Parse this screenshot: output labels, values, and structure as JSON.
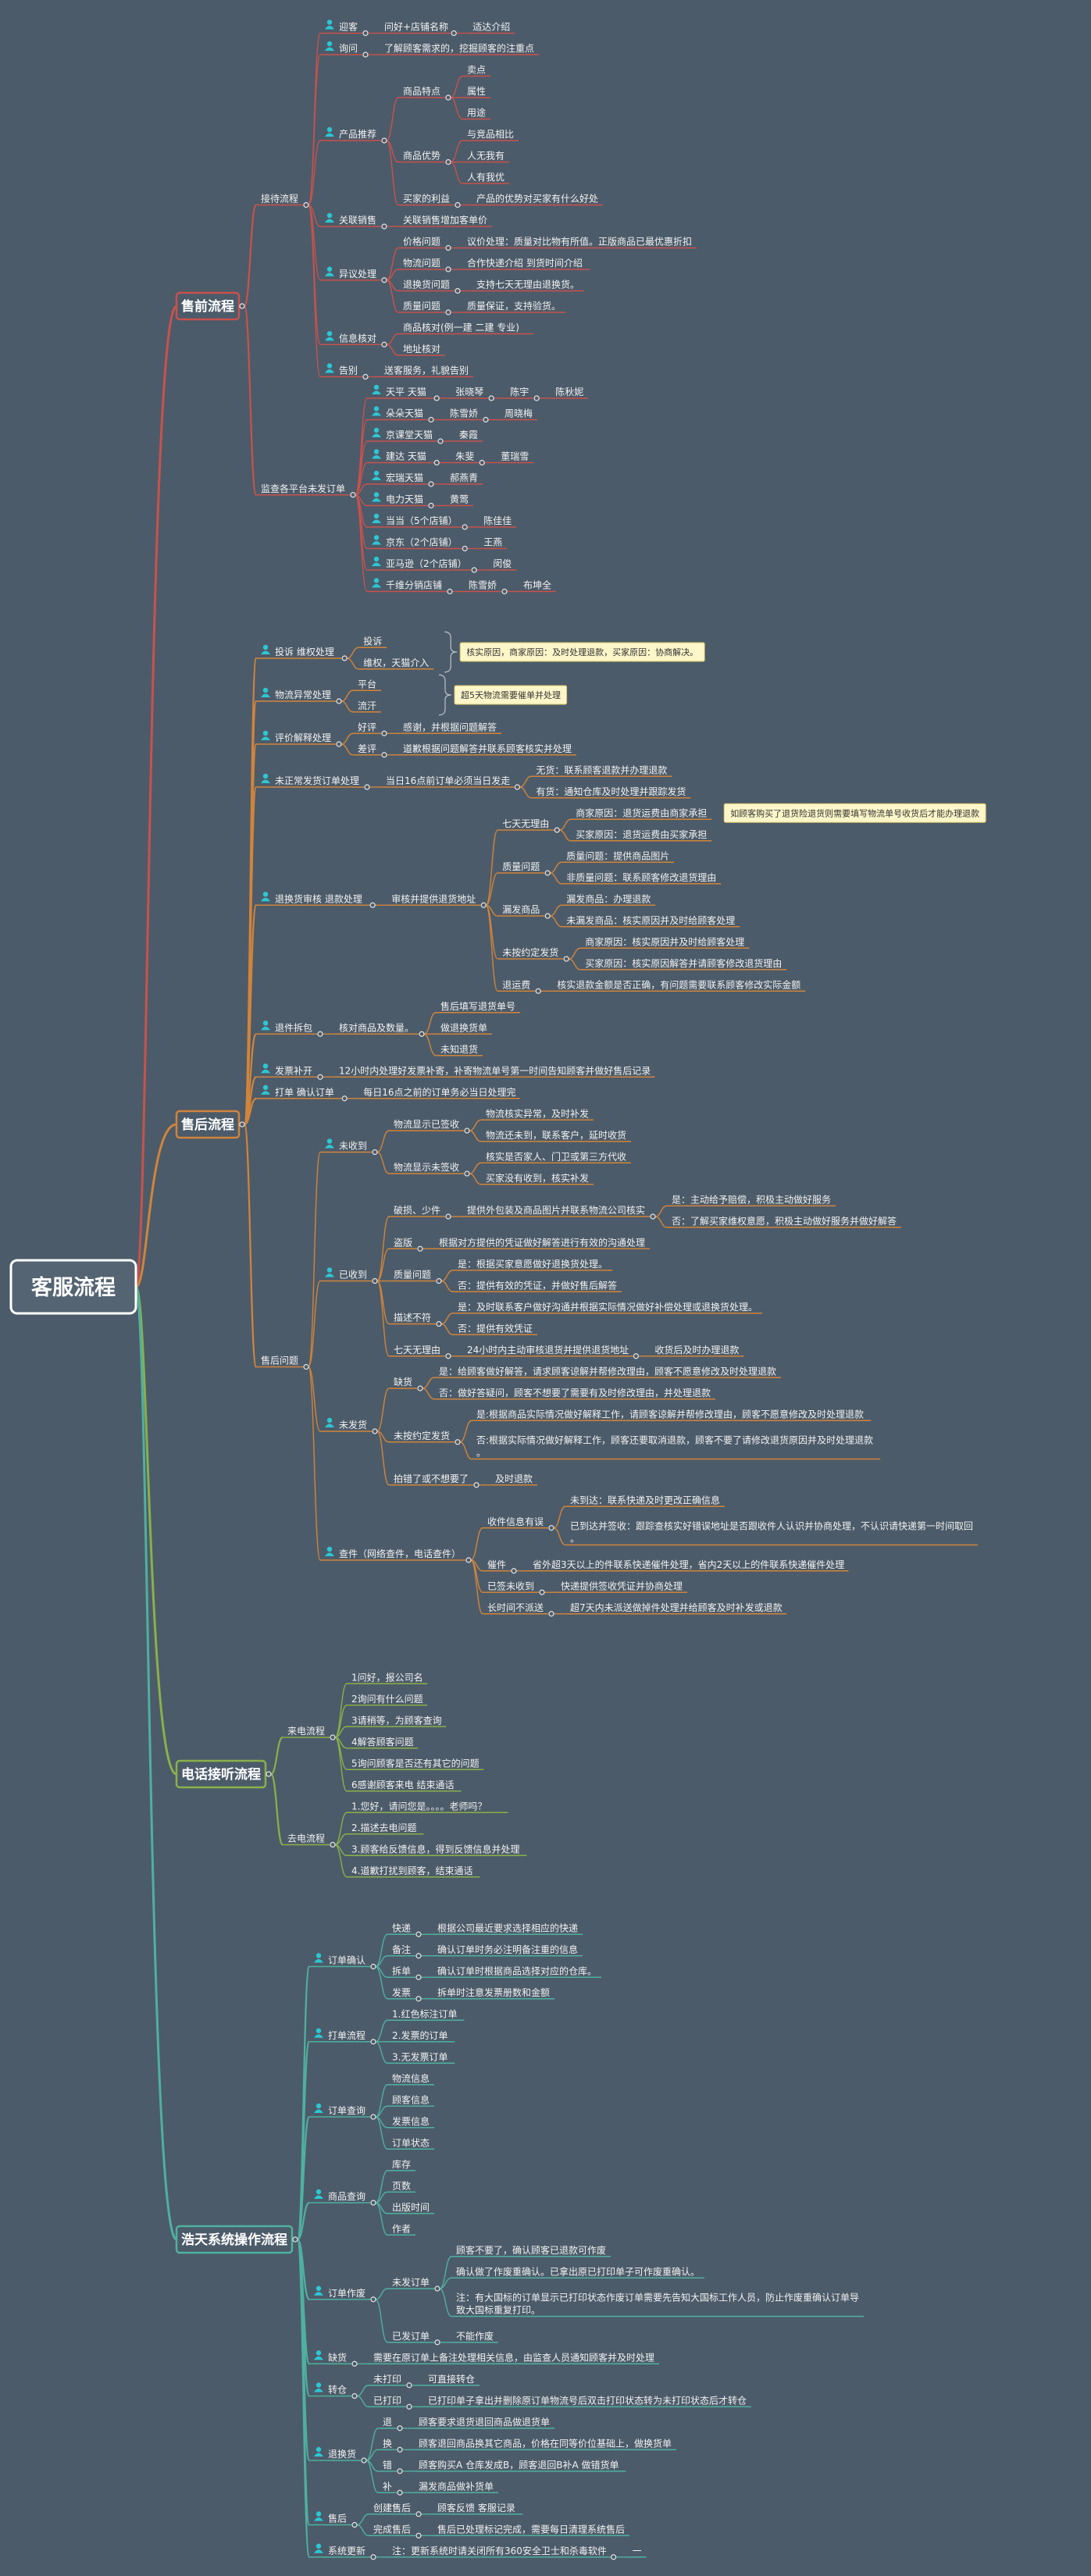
{
  "root": "客服流程",
  "colors": {
    "bg": "#4c5b69",
    "c1": "#c8524d",
    "c2": "#d1843b",
    "c3": "#8ab04a",
    "c4": "#4fb0a0",
    "person": "#2cc7d4",
    "note_bg": "#fdf6c8"
  },
  "tree": [
    {
      "t": "售前流程",
      "c": [
        {
          "t": "接待流程",
          "c": [
            {
              "t": "迎客",
              "p": 1,
              "c": [
                {
                  "t": "问好+店铺名称",
                  "c": [
                    {
                      "t": "适达介绍"
                    }
                  ]
                }
              ]
            },
            {
              "t": "询问",
              "p": 1,
              "c": [
                {
                  "t": "了解顾客需求的，挖掘顾客的注重点"
                }
              ]
            },
            {
              "t": "产品推荐",
              "p": 1,
              "c": [
                {
                  "t": "商品特点",
                  "c": [
                    {
                      "t": "卖点"
                    },
                    {
                      "t": "属性"
                    },
                    {
                      "t": "用途"
                    }
                  ]
                },
                {
                  "t": "商品优势",
                  "c": [
                    {
                      "t": "与竞品相比"
                    },
                    {
                      "t": "人无我有"
                    },
                    {
                      "t": "人有我优"
                    }
                  ]
                },
                {
                  "t": "买家的利益",
                  "c": [
                    {
                      "t": "产品的优势对买家有什么好处"
                    }
                  ]
                }
              ]
            },
            {
              "t": "关联销售",
              "p": 1,
              "c": [
                {
                  "t": "关联销售增加客单价"
                }
              ]
            },
            {
              "t": "异议处理",
              "p": 1,
              "c": [
                {
                  "t": "价格问题",
                  "c": [
                    {
                      "t": "议价处理：质量对比物有所值。正版商品已最优惠折扣"
                    }
                  ]
                },
                {
                  "t": "物流问题",
                  "c": [
                    {
                      "t": "合作快递介绍 到货时间介绍"
                    }
                  ]
                },
                {
                  "t": "退换货问题",
                  "c": [
                    {
                      "t": "支持七天无理由退换货。"
                    }
                  ]
                },
                {
                  "t": "质量问题",
                  "c": [
                    {
                      "t": "质量保证，支持验货。"
                    }
                  ]
                }
              ]
            },
            {
              "t": "信息核对",
              "p": 1,
              "c": [
                {
                  "t": "商品核对(例一建 二建 专业)"
                },
                {
                  "t": "地址核对"
                }
              ]
            },
            {
              "t": "告别",
              "p": 1,
              "c": [
                {
                  "t": "送客服务，礼貌告别"
                }
              ]
            }
          ]
        },
        {
          "t": "监查各平台未发订单",
          "c": [
            {
              "t": "天平 天猫",
              "p": 1,
              "c": [
                {
                  "t": "张晓琴",
                  "c": [
                    {
                      "t": "陈宇",
                      "c": [
                        {
                          "t": "陈秋妮"
                        }
                      ]
                    }
                  ]
                }
              ]
            },
            {
              "t": "朵朵天猫",
              "p": 1,
              "c": [
                {
                  "t": "陈雪娇",
                  "c": [
                    {
                      "t": "周晓梅"
                    }
                  ]
                }
              ]
            },
            {
              "t": "京课堂天猫",
              "p": 1,
              "c": [
                {
                  "t": "秦霞"
                }
              ]
            },
            {
              "t": "建达 天猫",
              "p": 1,
              "c": [
                {
                  "t": "朱斐",
                  "c": [
                    {
                      "t": "董瑞雪"
                    }
                  ]
                }
              ]
            },
            {
              "t": "宏瑞天猫",
              "p": 1,
              "c": [
                {
                  "t": "郝燕青"
                }
              ]
            },
            {
              "t": "电力天猫",
              "p": 1,
              "c": [
                {
                  "t": "黄莺"
                }
              ]
            },
            {
              "t": "当当（5个店铺）",
              "p": 1,
              "c": [
                {
                  "t": "陈佳佳"
                }
              ]
            },
            {
              "t": "京东（2个店铺）",
              "p": 1,
              "c": [
                {
                  "t": "王燕"
                }
              ]
            },
            {
              "t": "亚马逊（2个店铺）",
              "p": 1,
              "c": [
                {
                  "t": "闵俊"
                }
              ]
            },
            {
              "t": "千维分销店铺",
              "p": 1,
              "c": [
                {
                  "t": "陈雪娇",
                  "c": [
                    {
                      "t": "布坤全"
                    }
                  ]
                }
              ]
            }
          ]
        }
      ]
    },
    {
      "t": "售后流程",
      "c": [
        {
          "t": "投诉 维权处理",
          "p": 1,
          "note": "核实原因，商家原因：及时处理退款，买家原因：协商解决。",
          "c": [
            {
              "t": "投诉"
            },
            {
              "t": "维权，天猫介入"
            }
          ]
        },
        {
          "t": "物流异常处理",
          "p": 1,
          "note": "超5天物流需要催单并处理",
          "c": [
            {
              "t": "平台"
            },
            {
              "t": "流汗"
            }
          ]
        },
        {
          "t": "评价解释处理",
          "p": 1,
          "c": [
            {
              "t": "好评",
              "c": [
                {
                  "t": "感谢，并根据问题解答"
                }
              ]
            },
            {
              "t": "差评",
              "c": [
                {
                  "t": "道歉根据问题解答并联系顾客核实并处理"
                }
              ]
            }
          ]
        },
        {
          "t": "未正常发货订单处理",
          "p": 1,
          "c": [
            {
              "t": "当日16点前订单必须当日发走",
              "c": [
                {
                  "t": "无货：联系顾客退款并办理退款"
                },
                {
                  "t": "有货：通知仓库及时处理并跟踪发货"
                }
              ]
            }
          ]
        },
        {
          "t": "退换货审核 退款处理",
          "p": 1,
          "c": [
            {
              "t": "审核并提供退货地址",
              "c": [
                {
                  "t": "七天无理由",
                  "c": [
                    {
                      "t": "商家原因：退货运费由商家承担",
                      "note": "如顾客购买了退货险退货则需要填写物流单号收货后才能办理退款"
                    },
                    {
                      "t": "买家原因：退货运费由买家承担"
                    }
                  ]
                },
                {
                  "t": "质量问题",
                  "c": [
                    {
                      "t": "质量问题：提供商品图片"
                    },
                    {
                      "t": "非质量问题：联系顾客修改退货理由"
                    }
                  ]
                },
                {
                  "t": "漏发商品",
                  "c": [
                    {
                      "t": "漏发商品：办理退款"
                    },
                    {
                      "t": "未漏发商品：核实原因并及时给顾客处理"
                    }
                  ]
                },
                {
                  "t": "未按约定发货",
                  "c": [
                    {
                      "t": "商家原因：核实原因并及时给顾客处理"
                    },
                    {
                      "t": "买家原因：核实原因解答并请顾客修改退货理由"
                    }
                  ]
                },
                {
                  "t": "退运费",
                  "c": [
                    {
                      "t": "核实退款金额是否正确，有问题需要联系顾客修改实际金额"
                    }
                  ]
                }
              ]
            }
          ]
        },
        {
          "t": "退件拆包",
          "p": 1,
          "c": [
            {
              "t": "核对商品及数量。",
              "c": [
                {
                  "t": "售后填写退货单号"
                },
                {
                  "t": "做退换货单"
                },
                {
                  "t": "未知退货"
                }
              ]
            }
          ]
        },
        {
          "t": "发票补开",
          "p": 1,
          "c": [
            {
              "t": "12小时内处理好发票补寄，补寄物流单号第一时间告知顾客并做好售后记录"
            }
          ]
        },
        {
          "t": "打单 确认订单",
          "p": 1,
          "c": [
            {
              "t": "每日16点之前的订单务必当日处理完"
            }
          ]
        },
        {
          "t": "售后问题",
          "c": [
            {
              "t": "未收到",
              "p": 1,
              "c": [
                {
                  "t": "物流显示已签收",
                  "c": [
                    {
                      "t": "物流核实异常，及时补发"
                    },
                    {
                      "t": "物流还未到，联系客户，延时收货"
                    }
                  ]
                },
                {
                  "t": "物流显示未签收",
                  "c": [
                    {
                      "t": "核实是否家人、门卫或第三方代收"
                    },
                    {
                      "t": "买家没有收到，核实补发"
                    }
                  ]
                }
              ]
            },
            {
              "t": "已收到",
              "p": 1,
              "c": [
                {
                  "t": "破损、少件",
                  "c": [
                    {
                      "t": "提供外包装及商品图片并联系物流公司核实",
                      "c": [
                        {
                          "t": "是：主动给予赔偿，积极主动做好服务"
                        },
                        {
                          "t": "否：了解买家维权意愿，积极主动做好服务并做好解答"
                        }
                      ]
                    }
                  ]
                },
                {
                  "t": "盗版",
                  "c": [
                    {
                      "t": "根据对方提供的凭证做好解答进行有效的沟通处理"
                    }
                  ]
                },
                {
                  "t": "质量问题",
                  "c": [
                    {
                      "t": "是：根据买家意愿做好退换货处理。"
                    },
                    {
                      "t": "否：提供有效的凭证，并做好售后解答"
                    }
                  ]
                },
                {
                  "t": "描述不符",
                  "c": [
                    {
                      "t": "是：及时联系客户做好沟通并根据实际情况做好补偿处理或退换货处理。"
                    },
                    {
                      "t": "否：提供有效凭证"
                    }
                  ]
                },
                {
                  "t": "七天无理由",
                  "c": [
                    {
                      "t": "24小时内主动审核退货并提供退货地址",
                      "c": [
                        {
                          "t": "收货后及时办理退款"
                        }
                      ]
                    }
                  ]
                }
              ]
            },
            {
              "t": "未发货",
              "p": 1,
              "c": [
                {
                  "t": "缺货",
                  "c": [
                    {
                      "t": "是：给顾客做好解答，请求顾客谅解并帮修改理由，顾客不愿意修改及时处理退款"
                    },
                    {
                      "t": "否：做好答疑问，顾客不想要了需要有及时修改理由，并处理退款"
                    }
                  ]
                },
                {
                  "t": "未按约定发货",
                  "c": [
                    {
                      "t": "是:根据商品实际情况做好解释工作，请顾客谅解并帮修改理由，顾客不愿意修改及时处理退款"
                    },
                    {
                      "t": "否:根据实际情况做好解释工作，顾客还要取消退款，顾客不要了请修改退货原因并及时处理退款。"
                    }
                  ]
                },
                {
                  "t": "拍错了或不想要了",
                  "c": [
                    {
                      "t": "及时退款"
                    }
                  ]
                }
              ]
            },
            {
              "t": "查件（网络查件，电话查件）",
              "p": 1,
              "c": [
                {
                  "t": "收件信息有误",
                  "c": [
                    {
                      "t": "未到达：联系快递及时更改正确信息"
                    },
                    {
                      "t": "已到达并签收：跟踪查核实好错误地址是否跟收件人认识并协商处理，不认识请快递第一时间取回。"
                    }
                  ]
                },
                {
                  "t": "催件",
                  "c": [
                    {
                      "t": "省外超3天以上的件联系快递催件处理，省内2天以上的件联系快递催件处理"
                    }
                  ]
                },
                {
                  "t": "已签未收到",
                  "c": [
                    {
                      "t": "快递提供签收凭证并协商处理"
                    }
                  ]
                },
                {
                  "t": "长时间不派送",
                  "c": [
                    {
                      "t": "超7天内未派送做掉件处理并给顾客及时补发或退款"
                    }
                  ]
                }
              ]
            }
          ]
        }
      ]
    },
    {
      "t": "电话接听流程",
      "c": [
        {
          "t": "来电流程",
          "c": [
            {
              "t": "1问好，报公司名"
            },
            {
              "t": "2询问有什么问题"
            },
            {
              "t": "3请稍等，为顾客查询"
            },
            {
              "t": "4解答顾客问题"
            },
            {
              "t": "5询问顾客是否还有其它的问题"
            },
            {
              "t": "6感谢顾客来电 结束通话"
            }
          ]
        },
        {
          "t": "去电流程",
          "c": [
            {
              "t": "1.您好，请问您是。。。。老师吗？"
            },
            {
              "t": "2.描述去电问题"
            },
            {
              "t": "3.顾客给反馈信息，得到反馈信息并处理"
            },
            {
              "t": "4.道歉打扰到顾客，结束通话"
            }
          ]
        }
      ]
    },
    {
      "t": "浩天系统操作流程",
      "c": [
        {
          "t": "订单确认",
          "p": 1,
          "c": [
            {
              "t": "快递",
              "c": [
                {
                  "t": "根据公司最近要求选择相应的快递"
                }
              ]
            },
            {
              "t": "备注",
              "c": [
                {
                  "t": "确认订单时务必注明备注重的信息"
                }
              ]
            },
            {
              "t": "拆单",
              "c": [
                {
                  "t": "确认订单时根据商品选择对应的仓库。"
                }
              ]
            },
            {
              "t": "发票",
              "c": [
                {
                  "t": "拆单时注意发票册数和金额"
                }
              ]
            }
          ]
        },
        {
          "t": "打单流程",
          "p": 1,
          "c": [
            {
              "t": "1.红色标注订单"
            },
            {
              "t": "2.发票的订单"
            },
            {
              "t": "3.无发票订单"
            }
          ]
        },
        {
          "t": "订单查询",
          "p": 1,
          "c": [
            {
              "t": "物流信息"
            },
            {
              "t": "顾客信息"
            },
            {
              "t": "发票信息"
            },
            {
              "t": "订单状态"
            }
          ]
        },
        {
          "t": "商品查询",
          "p": 1,
          "c": [
            {
              "t": "库存"
            },
            {
              "t": "页数"
            },
            {
              "t": "出版时间"
            },
            {
              "t": "作者"
            }
          ]
        },
        {
          "t": "订单作废",
          "p": 1,
          "c": [
            {
              "t": "未发订单",
              "c": [
                {
                  "t": "顾客不要了，确认顾客已退款可作废"
                },
                {
                  "t": "确认做了作废重确认。已拿出原已打印单子可作废重确认。"
                },
                {
                  "t": "注：有大国标的订单显示已打印状态作废订单需要先告知大国标工作人员，防止作废重确认订单导致大国标重复打印。"
                }
              ]
            },
            {
              "t": "已发订单",
              "c": [
                {
                  "t": "不能作废"
                }
              ]
            }
          ]
        },
        {
          "t": "缺货",
          "p": 1,
          "c": [
            {
              "t": "需要在原订单上备注处理相关信息，由监查人员通知顾客并及时处理"
            }
          ]
        },
        {
          "t": "转仓",
          "p": 1,
          "c": [
            {
              "t": "未打印",
              "c": [
                {
                  "t": "可直接转仓"
                }
              ]
            },
            {
              "t": "已打印",
              "c": [
                {
                  "t": "已打印单子拿出并删除原订单物流号后双击打印状态转为未打印状态后才转仓"
                }
              ]
            }
          ]
        },
        {
          "t": "退换货",
          "p": 1,
          "c": [
            {
              "t": "退",
              "c": [
                {
                  "t": "顾客要求退货退回商品做退货单"
                }
              ]
            },
            {
              "t": "换",
              "c": [
                {
                  "t": "顾客退回商品换其它商品，价格在同等价位基础上，做换货单"
                }
              ]
            },
            {
              "t": "错",
              "c": [
                {
                  "t": "顾客购买A 仓库发成B，顾客退回B补A 做错货单"
                }
              ]
            },
            {
              "t": "补",
              "c": [
                {
                  "t": "漏发商品做补货单"
                }
              ]
            }
          ]
        },
        {
          "t": "售后",
          "p": 1,
          "c": [
            {
              "t": "创建售后",
              "c": [
                {
                  "t": "顾客反馈 客服记录"
                }
              ]
            },
            {
              "t": "完成售后",
              "c": [
                {
                  "t": "售后已处理标记完成，需要每日清理系统售后"
                }
              ]
            }
          ]
        },
        {
          "t": "系统更新",
          "p": 1,
          "c": [
            {
              "t": "注：更新系统时请关闭所有360安全卫士和杀毒软件",
              "c": [
                {
                  "t": "一"
                }
              ]
            }
          ]
        }
      ]
    }
  ]
}
